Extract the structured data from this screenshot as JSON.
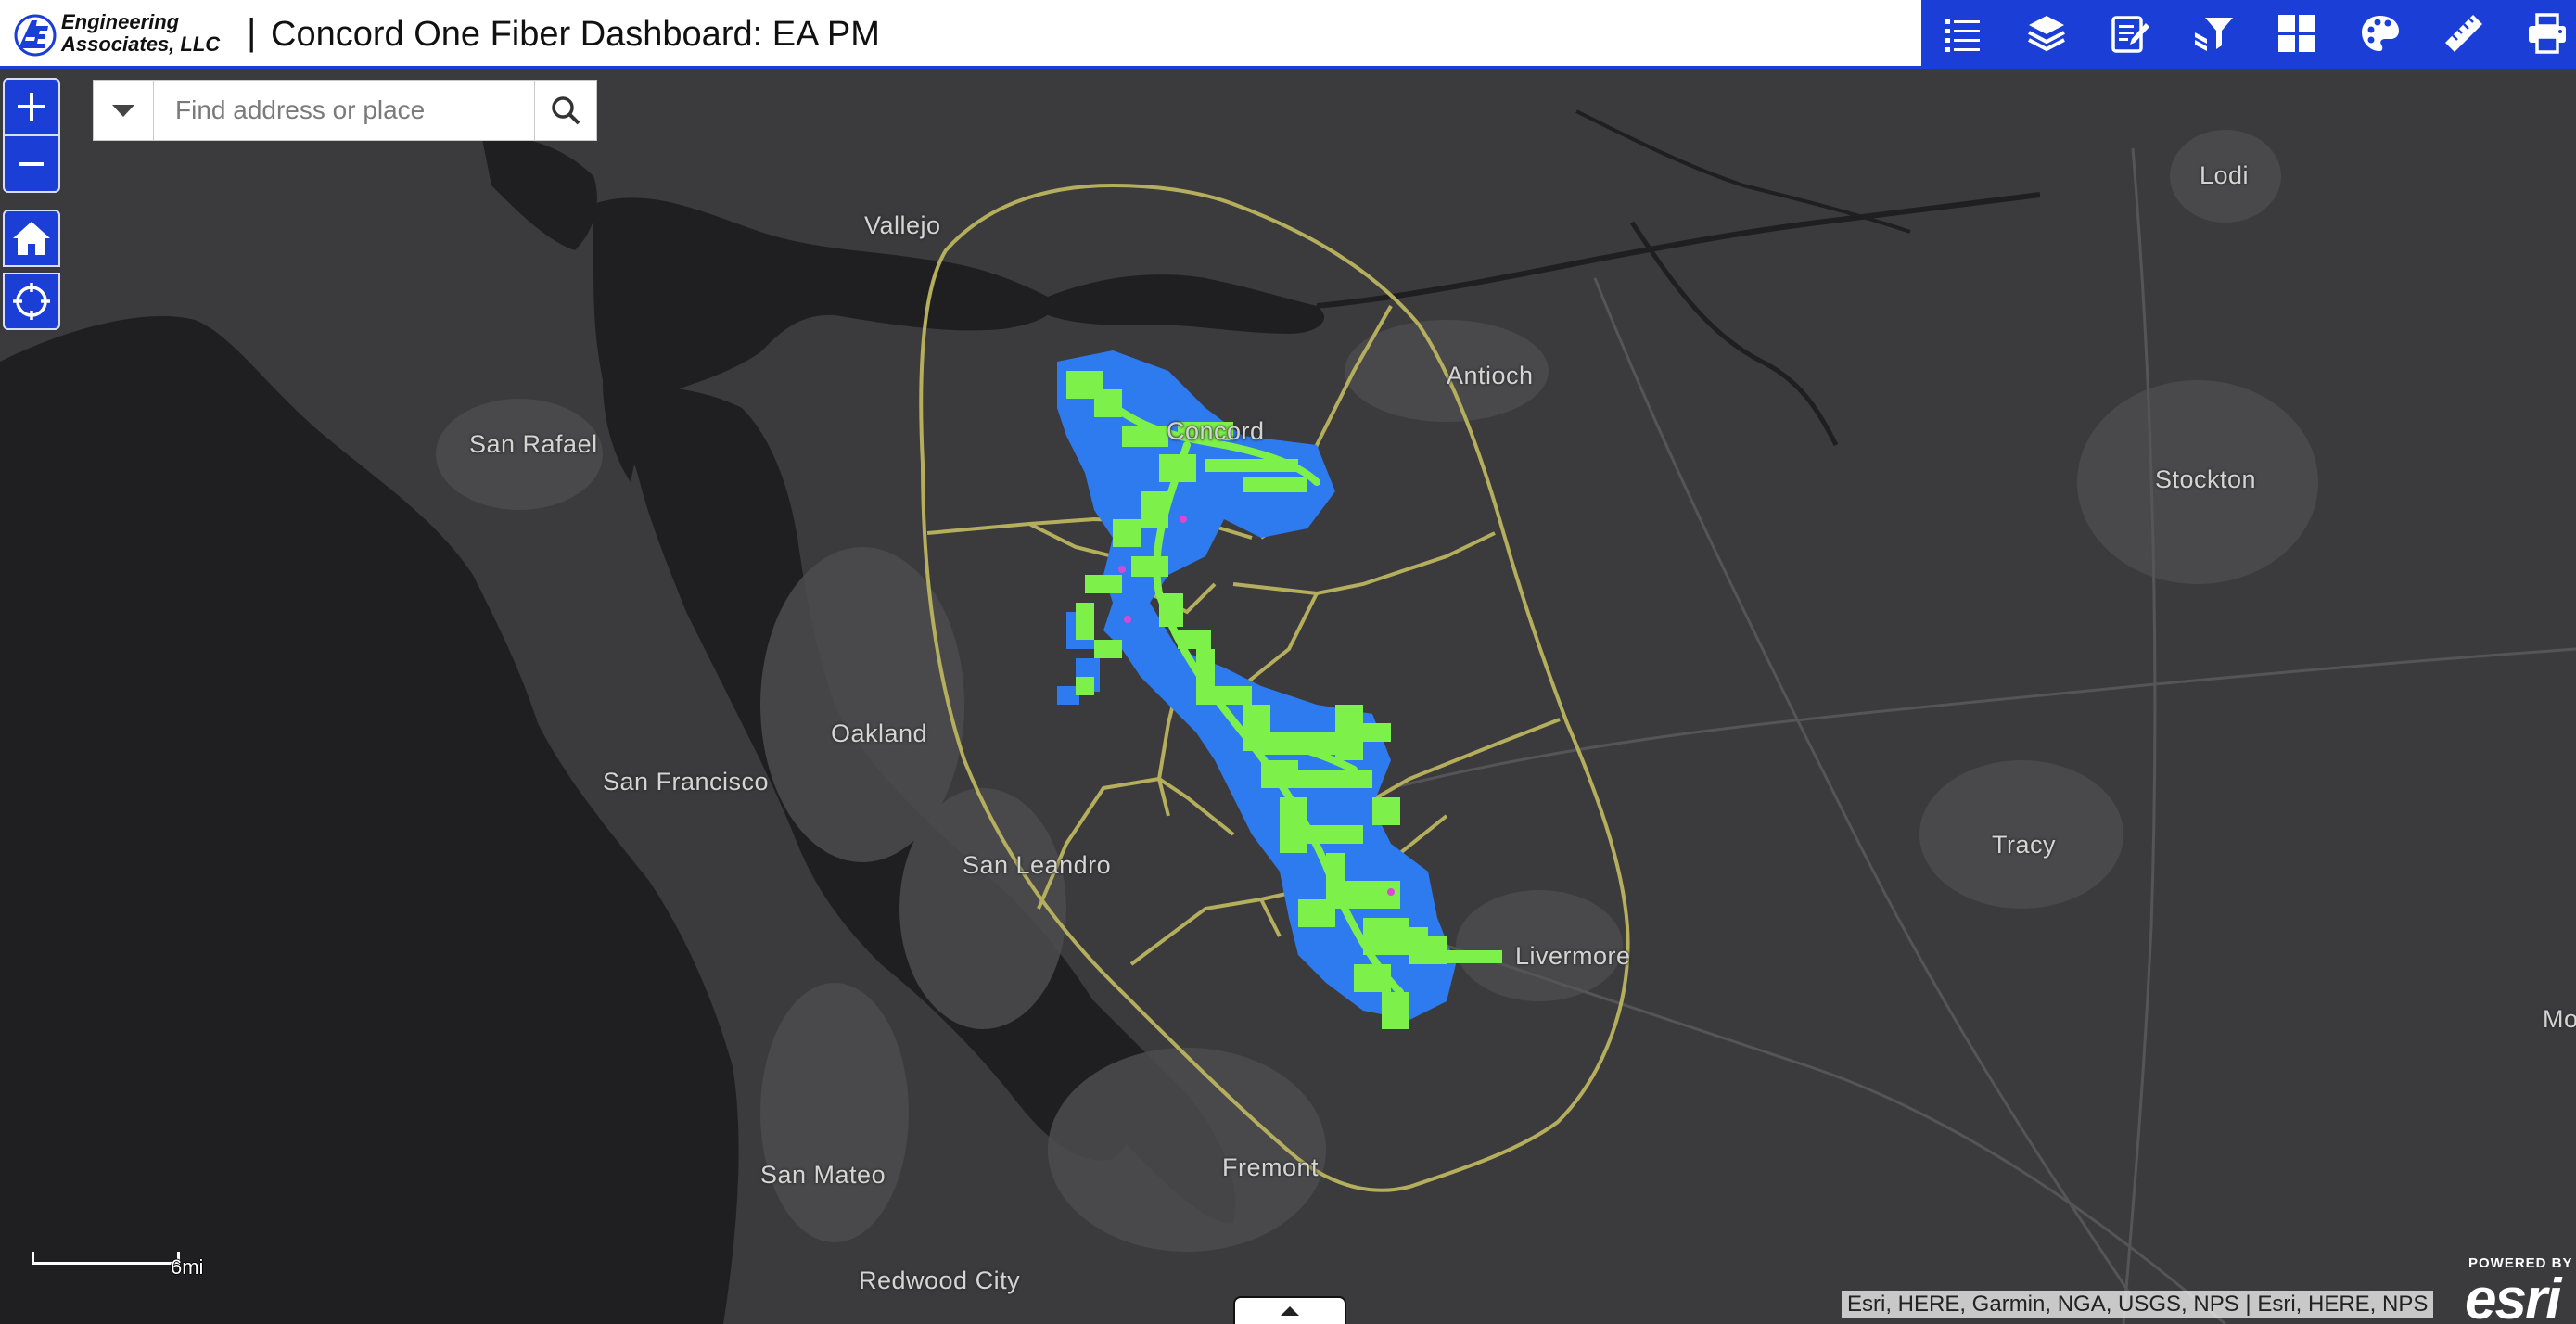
{
  "header": {
    "logo_line1": "Engineering",
    "logo_line2": "Associates, LLC",
    "separator": "|",
    "title": "Concord One Fiber Dashboard: EA PM"
  },
  "toolbar": {
    "tools": [
      {
        "name": "legend",
        "icon": "legend-list-icon"
      },
      {
        "name": "layers",
        "icon": "layers-icon"
      },
      {
        "name": "edit",
        "icon": "edit-icon"
      },
      {
        "name": "filter",
        "icon": "layer-filter-icon"
      },
      {
        "name": "apps",
        "icon": "grid-icon"
      },
      {
        "name": "basemap",
        "icon": "palette-icon"
      },
      {
        "name": "measure",
        "icon": "ruler-icon"
      },
      {
        "name": "print",
        "icon": "print-icon"
      }
    ]
  },
  "search": {
    "placeholder": "Find address or place"
  },
  "map": {
    "places": [
      {
        "name": "Lodi"
      },
      {
        "name": "Vallejo"
      },
      {
        "name": "Antioch"
      },
      {
        "name": "Concord"
      },
      {
        "name": "San Rafael"
      },
      {
        "name": "Stockton"
      },
      {
        "name": "Oakland"
      },
      {
        "name": "San Francisco"
      },
      {
        "name": "San Leandro"
      },
      {
        "name": "Tracy"
      },
      {
        "name": "Livermore"
      },
      {
        "name": "San Mateo"
      },
      {
        "name": "Fremont"
      },
      {
        "name": "Redwood City"
      },
      {
        "name": "Mo"
      }
    ],
    "scale_label": "6mi",
    "attribution": "Esri, HERE, Garmin, NGA, USGS, NPS | Esri, HERE, NPS",
    "powered_by": "POWERED BY",
    "esri_word": "esri",
    "colors": {
      "water": "#1f1f22",
      "land": "#3b3b3d",
      "urban": "#4c4c4e",
      "boundary": "#b5ae5d",
      "fiber_blue": "#2e7bf0",
      "fiber_green": "#7ef04a",
      "accent": "#1b3fd6"
    }
  }
}
